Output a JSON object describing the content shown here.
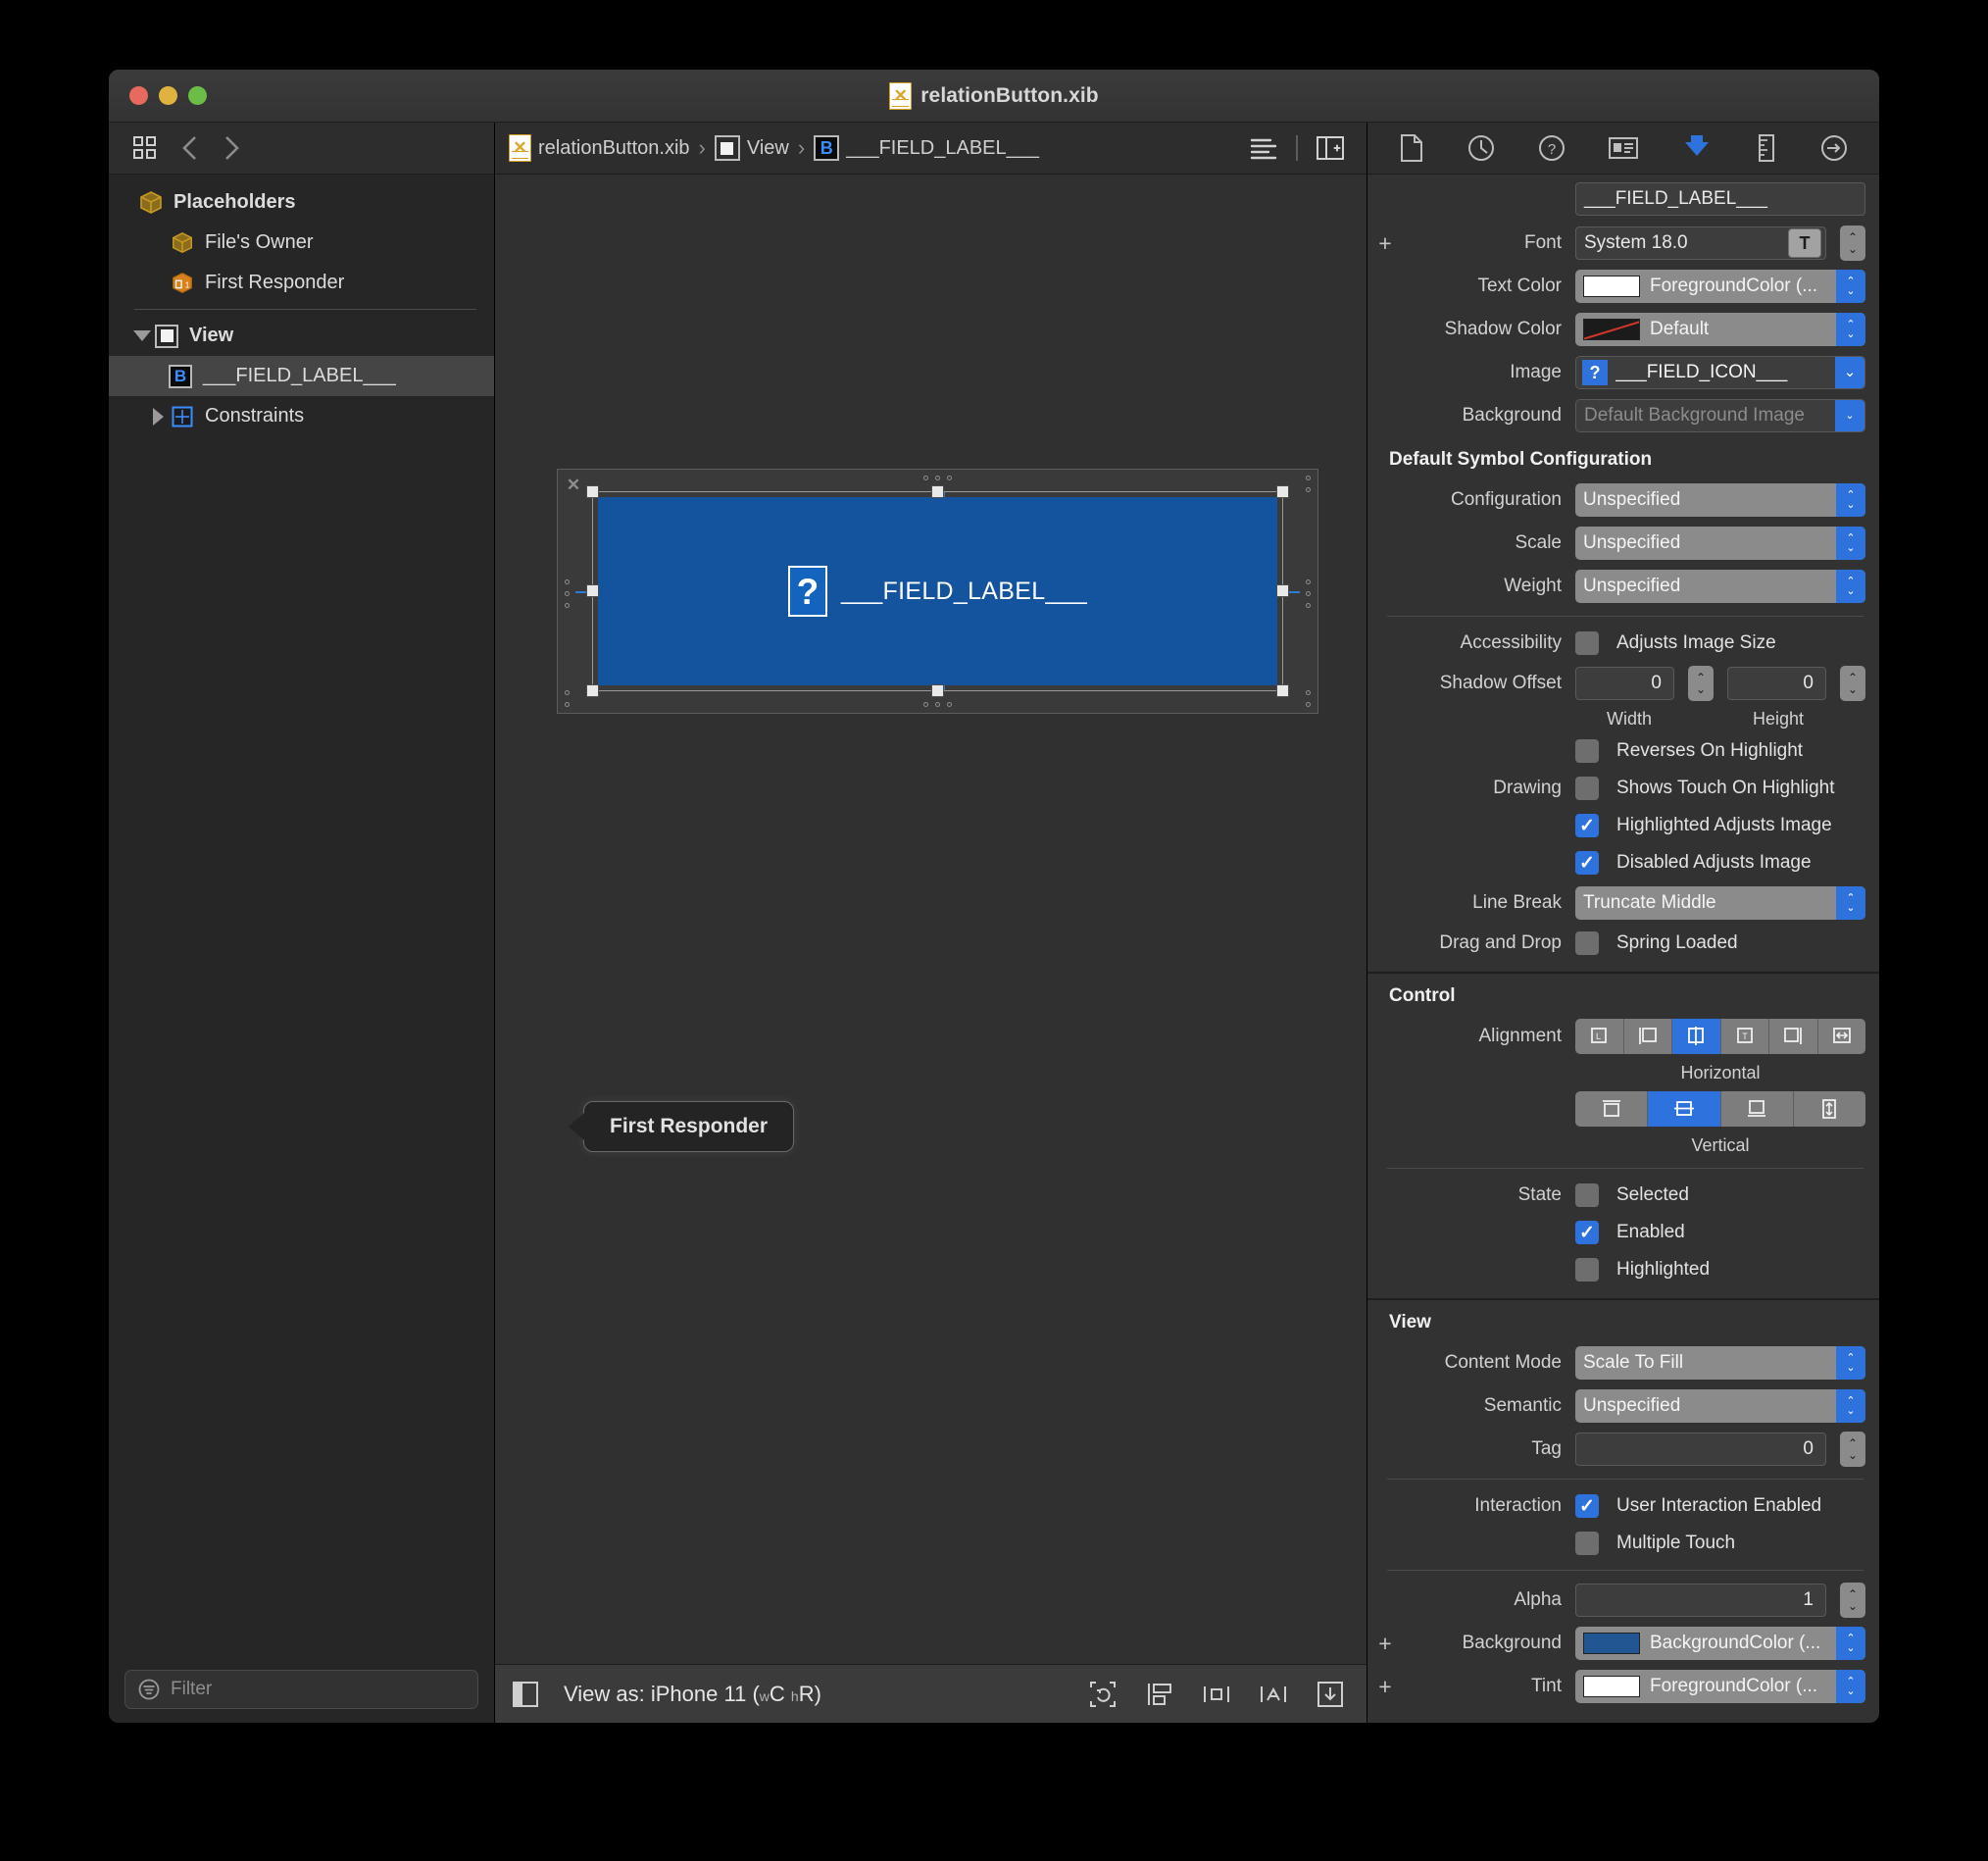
{
  "window": {
    "title": "relationButton.xib"
  },
  "navigator": {
    "toolbar_icons": [
      "grid-icon",
      "back-chevron-icon",
      "forward-chevron-icon"
    ],
    "items": [
      {
        "label": "Placeholders",
        "icon": "cube-icon",
        "level": 0,
        "bold": true,
        "selected": false,
        "disclosure": "none"
      },
      {
        "label": "File's Owner",
        "icon": "cube-icon",
        "level": 1,
        "bold": false,
        "selected": false,
        "disclosure": "none"
      },
      {
        "label": "First Responder",
        "icon": "responder-cube-icon",
        "level": 1,
        "bold": false,
        "selected": false,
        "disclosure": "none"
      },
      {
        "label": "View",
        "icon": "view-square-icon",
        "level": 0,
        "bold": true,
        "selected": false,
        "disclosure": "open"
      },
      {
        "label": "___FIELD_LABEL___",
        "icon": "button-b-icon",
        "level": 1,
        "bold": false,
        "selected": true,
        "disclosure": "none"
      },
      {
        "label": "Constraints",
        "icon": "constraints-icon",
        "level": 1,
        "bold": false,
        "selected": false,
        "disclosure": "closed"
      }
    ],
    "filter": {
      "placeholder": "Filter",
      "value": "",
      "icon": "filter-icon"
    }
  },
  "breadcrumb": {
    "file": "relationButton.xib",
    "view": "View",
    "element": "___FIELD_LABEL___",
    "separator": "›"
  },
  "editor_toolbar": {
    "icons": [
      "align-lines-icon",
      "assistant-editor-add-icon"
    ]
  },
  "canvas": {
    "button": {
      "label": "___FIELD_LABEL___",
      "icon": "placeholder-question-icon"
    },
    "first_responder_node": "First Responder"
  },
  "editor_bottom": {
    "panel_toggle": "left-panel-toggle-icon",
    "view_as_prefix": "View as: ",
    "view_as_device": "iPhone 11",
    "size_class_open": "(",
    "w_sub": "w",
    "w_val": "C",
    "h_sub": "h",
    "h_val": "R",
    "size_class_close": ")",
    "icons": [
      "update-frames-icon",
      "embed-in-icon",
      "align-icon",
      "add-constraints-icon",
      "resolve-issues-icon"
    ]
  },
  "inspector": {
    "tabs": [
      {
        "name": "file-inspector-icon",
        "active": false
      },
      {
        "name": "history-inspector-icon",
        "active": false
      },
      {
        "name": "quick-help-inspector-icon",
        "active": false
      },
      {
        "name": "identity-inspector-icon",
        "active": false
      },
      {
        "name": "attributes-inspector-icon",
        "active": true
      },
      {
        "name": "size-inspector-icon",
        "active": false
      },
      {
        "name": "connections-inspector-icon",
        "active": false
      }
    ],
    "title_field": {
      "value": "___FIELD_LABEL___"
    },
    "font": {
      "label": "Font",
      "value": "System 18.0",
      "plus": "+",
      "button_icon": "font-panel-icon"
    },
    "text_color": {
      "label": "Text Color",
      "value": "ForegroundColor (...",
      "swatch": "#ffffff"
    },
    "shadow_color": {
      "label": "Shadow Color",
      "value": "Default",
      "swatch": "default-none"
    },
    "image": {
      "label": "Image",
      "value": "___FIELD_ICON___",
      "icon": "placeholder-question-icon"
    },
    "background_image": {
      "label": "Background",
      "placeholder": "Default Background Image"
    },
    "symbol_section": {
      "header": "Default Symbol Configuration",
      "rows": [
        {
          "label": "Configuration",
          "value": "Unspecified"
        },
        {
          "label": "Scale",
          "value": "Unspecified"
        },
        {
          "label": "Weight",
          "value": "Unspecified"
        }
      ]
    },
    "accessibility": {
      "label": "Accessibility",
      "checkbox": "Adjusts Image Size",
      "checked": false
    },
    "shadow_offset": {
      "label": "Shadow Offset",
      "width_value": "0",
      "height_value": "0",
      "width_label": "Width",
      "height_label": "Height"
    },
    "drawing": {
      "label": "Drawing",
      "options": [
        {
          "text": "Reverses On Highlight",
          "checked": false
        },
        {
          "text": "Shows Touch On Highlight",
          "checked": false
        },
        {
          "text": "Highlighted Adjusts Image",
          "checked": true
        },
        {
          "text": "Disabled Adjusts Image",
          "checked": true
        }
      ]
    },
    "line_break": {
      "label": "Line Break",
      "value": "Truncate Middle"
    },
    "drag_and_drop": {
      "label": "Drag and Drop",
      "checkbox": "Spring Loaded",
      "checked": false
    },
    "control_section": {
      "header": "Control",
      "alignment_label": "Alignment",
      "horizontal_label": "Horizontal",
      "vertical_label": "Vertical",
      "horizontal_selected_index": 2,
      "vertical_selected_index": 1,
      "horizontal_icons": [
        "align-leading-icon",
        "align-left-icon",
        "align-center-icon",
        "align-text-icon",
        "align-right-icon",
        "align-fill-horizontal-icon"
      ],
      "vertical_icons": [
        "align-top-icon",
        "align-middle-icon",
        "align-bottom-icon",
        "align-fill-vertical-icon"
      ],
      "state_label": "State",
      "state_options": [
        {
          "text": "Selected",
          "checked": false
        },
        {
          "text": "Enabled",
          "checked": true
        },
        {
          "text": "Highlighted",
          "checked": false
        }
      ]
    },
    "view_section": {
      "header": "View",
      "content_mode": {
        "label": "Content Mode",
        "value": "Scale To Fill"
      },
      "semantic": {
        "label": "Semantic",
        "value": "Unspecified"
      },
      "tag": {
        "label": "Tag",
        "value": "0"
      },
      "interaction_label": "Interaction",
      "interaction_options": [
        {
          "text": "User Interaction Enabled",
          "checked": true
        },
        {
          "text": "Multiple Touch",
          "checked": false
        }
      ],
      "alpha": {
        "label": "Alpha",
        "value": "1"
      },
      "background": {
        "label": "Background",
        "value": "BackgroundColor (...",
        "swatch": "#225693",
        "plus": "+"
      },
      "tint": {
        "label": "Tint",
        "value": "ForegroundColor (...",
        "swatch": "#ffffff",
        "plus": "+"
      }
    }
  },
  "colors": {
    "accent_blue": "#2e72dd",
    "button_blue": "#14539e",
    "window_bg": "#2b2b2b",
    "inspector_bg": "#323232"
  }
}
